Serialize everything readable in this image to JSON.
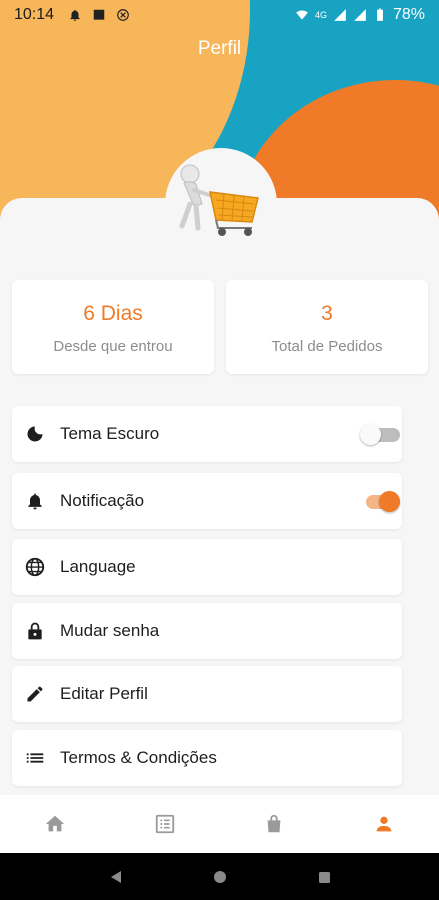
{
  "status_bar": {
    "time": "10:14",
    "network": "4G",
    "battery": "78%"
  },
  "page": {
    "title": "Perfil"
  },
  "stats": [
    {
      "value": "6 Dias",
      "label": "Desde que entrou"
    },
    {
      "value": "3",
      "label": "Total de Pedidos"
    }
  ],
  "settings": [
    {
      "label": "Tema Escuro",
      "icon": "moon-icon",
      "toggle": false
    },
    {
      "label": "Notificação",
      "icon": "bell-icon",
      "toggle": true
    },
    {
      "label": "Language",
      "icon": "globe-icon"
    },
    {
      "label": "Mudar senha",
      "icon": "lock-icon"
    },
    {
      "label": "Editar Perfil",
      "icon": "pencil-icon"
    },
    {
      "label": "Termos & Condições",
      "icon": "list-icon"
    }
  ],
  "bottom_nav": {
    "items": [
      "home-icon",
      "orders-icon",
      "bag-icon",
      "profile-icon"
    ],
    "active": "profile-icon"
  },
  "colors": {
    "accent": "#ef7a27",
    "teal": "#19a3c2",
    "yellow": "#f7b65a",
    "inactive_icon": "#9a9a9a"
  }
}
